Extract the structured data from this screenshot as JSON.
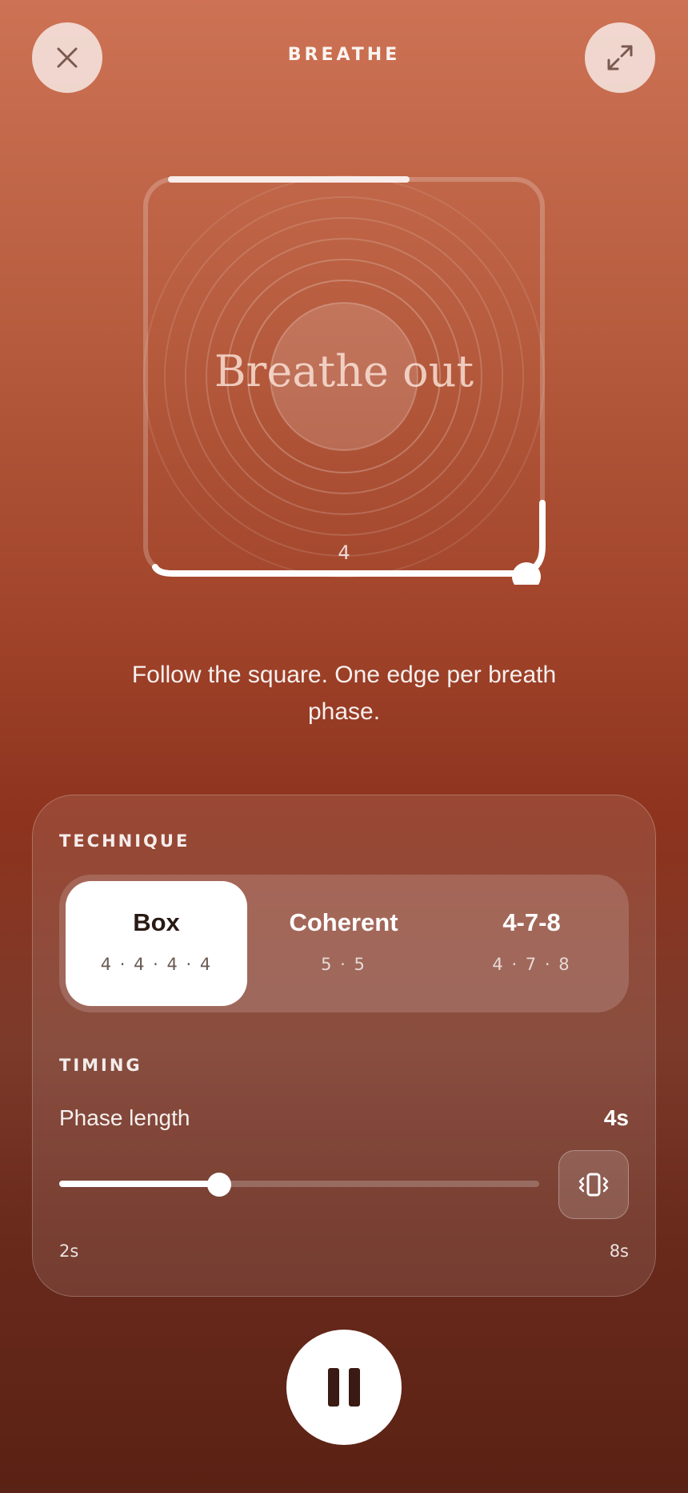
{
  "header": {
    "title": "BREATHE",
    "close_icon": "close-icon",
    "expand_icon": "expand-icon"
  },
  "visualization": {
    "phase_text": "Breathe out",
    "counter": "4",
    "phase_progress": 0.6
  },
  "instruction": "Follow the square. One edge per breath phase.",
  "technique": {
    "label": "TECHNIQUE",
    "options": [
      {
        "name": "Box",
        "pattern": "4 · 4 · 4 · 4",
        "selected": true
      },
      {
        "name": "Coherent",
        "pattern": "5 · 5",
        "selected": false
      },
      {
        "name": "4-7-8",
        "pattern": "4 · 7 · 8",
        "selected": false
      }
    ]
  },
  "timing": {
    "label": "TIMING",
    "phase_length_label": "Phase length",
    "phase_length_value": "4s",
    "slider_min": "2s",
    "slider_max": "8s",
    "slider_value": 4,
    "haptic_icon": "vibrate-icon"
  },
  "controls": {
    "pause_icon": "pause-icon"
  },
  "colors": {
    "accent": "#ffffff",
    "bg_top": "#cd7254",
    "bg_bottom": "#5a2214"
  }
}
